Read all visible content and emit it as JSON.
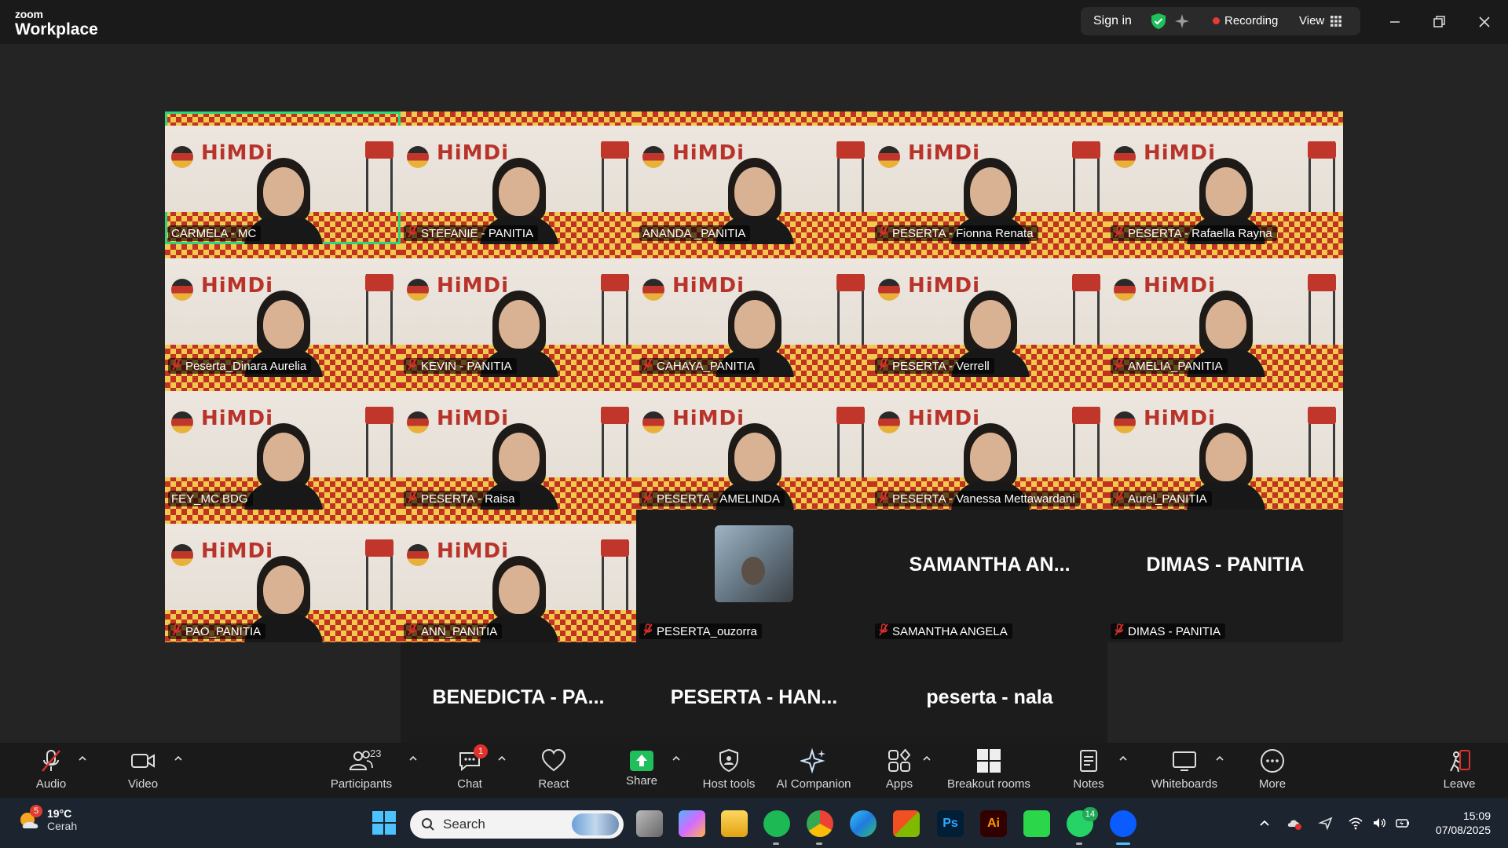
{
  "app": {
    "brand_small": "zoom",
    "brand_large": "Workplace",
    "signin_label": "Sign in",
    "recording_label": "Recording",
    "view_label": "View"
  },
  "participants": [
    {
      "name": "CARMELA - MC",
      "muted": false,
      "video": true,
      "active": true
    },
    {
      "name": "STEFANIE - PANITIA",
      "muted": true,
      "video": true,
      "active": false
    },
    {
      "name": "ANANDA _PANITIA",
      "muted": false,
      "video": true,
      "active": false
    },
    {
      "name": "PESERTA - Fionna Renata",
      "muted": true,
      "video": true,
      "active": false
    },
    {
      "name": "PESERTA - Rafaella Rayna",
      "muted": true,
      "video": true,
      "active": false
    },
    {
      "name": "Peserta_Dinara Aurelia",
      "muted": true,
      "video": true,
      "active": false
    },
    {
      "name": "KEVIN - PANITIA",
      "muted": true,
      "video": true,
      "active": false
    },
    {
      "name": "CAHAYA_PANITIA",
      "muted": true,
      "video": true,
      "active": false
    },
    {
      "name": "PESERTA - Verrell",
      "muted": true,
      "video": true,
      "active": false
    },
    {
      "name": "AMELIA_PANITIA",
      "muted": true,
      "video": true,
      "active": false
    },
    {
      "name": "FEY_MC BDG",
      "muted": false,
      "video": true,
      "active": false
    },
    {
      "name": "PESERTA - Raisa",
      "muted": true,
      "video": true,
      "active": false
    },
    {
      "name": "PESERTA - AMELINDA",
      "muted": true,
      "video": true,
      "active": false
    },
    {
      "name": "PESERTA - Vanessa Mettawardani",
      "muted": true,
      "video": true,
      "active": false
    },
    {
      "name": "Aurel_PANITIA",
      "muted": true,
      "video": true,
      "active": false
    },
    {
      "name": "PAO_PANITIA",
      "muted": true,
      "video": true,
      "active": false
    },
    {
      "name": "ANN_PANITIA",
      "muted": true,
      "video": true,
      "active": false
    },
    {
      "name": "PESERTA_ouzorra",
      "muted": true,
      "video": false,
      "avatar": true
    },
    {
      "name": "SAMANTHA ANGELA",
      "muted": true,
      "video": false,
      "display": "SAMANTHA  AN..."
    },
    {
      "name": "DIMAS - PANITIA",
      "muted": true,
      "video": false,
      "display": "DIMAS - PANITIA"
    },
    {
      "name": "BENEDICTA - PANITIIA",
      "muted": true,
      "video": false,
      "display": "BENEDICTA - PA..."
    },
    {
      "name": "PESERTA - HANSEL",
      "muted": true,
      "video": false,
      "display": "PESERTA - HAN..."
    },
    {
      "name": "peserta - nala",
      "muted": true,
      "video": false,
      "display": "peserta - nala"
    }
  ],
  "banner_text": "HiMDi",
  "toolbar": {
    "audio": "Audio",
    "video": "Video",
    "participants": "Participants",
    "participants_count": "23",
    "chat": "Chat",
    "chat_badge": "1",
    "react": "React",
    "share": "Share",
    "host_tools": "Host tools",
    "ai_companion": "AI Companion",
    "apps": "Apps",
    "breakout_rooms": "Breakout rooms",
    "notes": "Notes",
    "whiteboards": "Whiteboards",
    "more": "More",
    "leave": "Leave"
  },
  "taskbar": {
    "weather_temp": "19°C",
    "weather_desc": "Cerah",
    "weather_badge": "5",
    "search_label": "Search",
    "whatsapp_badge": "14",
    "time": "15:09",
    "date": "07/08/2025"
  },
  "colors": {
    "active_speaker": "#2bd67b",
    "recording": "#e63a3a",
    "share": "#1fbf5b",
    "badge": "#e0312b"
  }
}
